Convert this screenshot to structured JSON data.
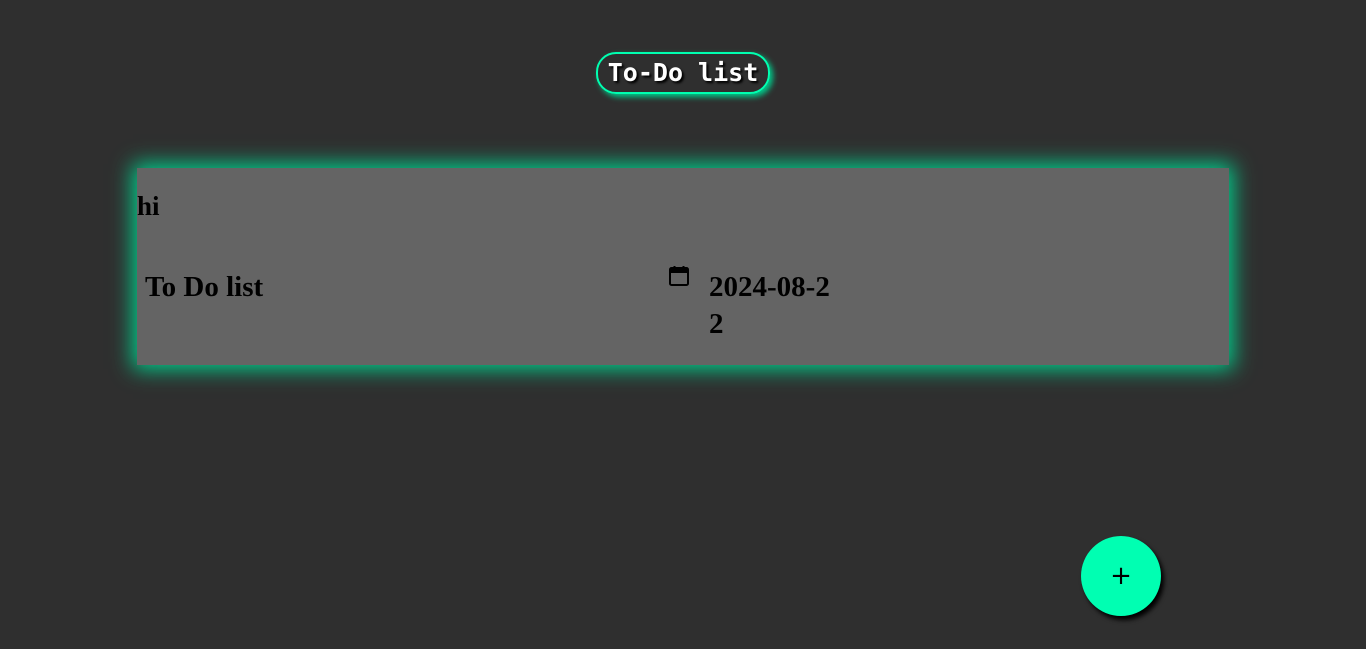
{
  "header": {
    "title": "To-Do list"
  },
  "todo": {
    "heading": "hi",
    "text": "To Do list",
    "date": "2024-08-22",
    "date_icon": "calendar-icon"
  },
  "fab": {
    "label": "+"
  },
  "colors": {
    "background": "#2f2f2f",
    "card": "#646464",
    "accent": "#00ffb2",
    "glow": "#00d28f"
  }
}
